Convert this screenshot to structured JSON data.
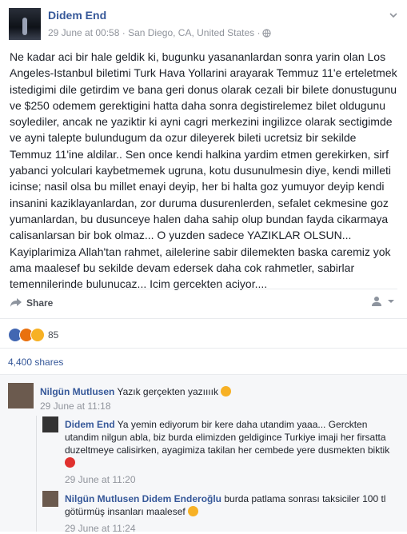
{
  "post": {
    "author": "Didem End",
    "meta": "29 June at 00:58 · San Diego, CA, United States · ",
    "text": "Ne kadar aci bir hale geldik ki, bugunku yasananlardan sonra yarin olan Los Angeles-Istanbul biletimi Turk Hava Yollarini arayarak Temmuz 11'e erteletmek istedigimi dile getirdim ve bana geri donus olarak cezali bir bilete donustugunu ve $250 odemem gerektigini hatta daha sonra degistirelemez bilet oldugunu soylediler, ancak ne yaziktir ki ayni cagri merkezini ingilizce olarak sectigimde ve ayni talepte bulundugum da ozur dileyerek bileti ucretsiz bir sekilde Temmuz 11'ine aldilar.. Sen once kendi halkina yardim etmen gerekirken, sirf yabanci yolculari kaybetmemek ugruna, kotu dusunulmesin diye, kendi milleti icinse; nasil olsa bu millet enayi deyip, her bi halta goz yumuyor deyip kendi insanini kaziklayanlardan, zor duruma dusurenlerden, sefalet cekmesine goz yumanlardan, bu dusunceye halen daha sahip olup bundan fayda cikarmaya calisanlarsan bir bok olmaz... O yuzden sadece YAZIKLAR OLSUN... Kayiplarimiza Allah'tan rahmet, ailelerine sabir dilemekten baska caremiz yok ama maalesef bu sekilde devam edersek daha cok rahmetler, sabirlar temennilerinde bulunucaz... Icim gercekten aciyor...."
  },
  "actions": {
    "share_label": "Share"
  },
  "reactions": {
    "count": "85"
  },
  "shares": {
    "label": "4,400 shares"
  },
  "comments": [
    {
      "author": "Nilgün Mutlusen",
      "text": "Yazık gerçekten yazıııık",
      "time": "29 June at 11:18"
    },
    {
      "author": "Didem End",
      "text": "Ya yemin ediyorum bir kere daha utandim yaaa... Gerckten utandim nilgun abla, biz burda elimizden geldigince Turkiye imaji her firsatta duzeltmeye calisirken, ayagimiza takilan her cembede yere dusmekten biktik",
      "time": "29 June at 11:20"
    },
    {
      "author": "Nilgün Mutlusen",
      "mention": "Didem Enderoğlu",
      "text": "burda patlama sonrası taksiciler 100 tl götürmüş insanları maalesef",
      "time": "29 June at 11:24"
    }
  ],
  "colors": {
    "link": "#365899",
    "meta": "#90949c",
    "text": "#1d2129"
  }
}
